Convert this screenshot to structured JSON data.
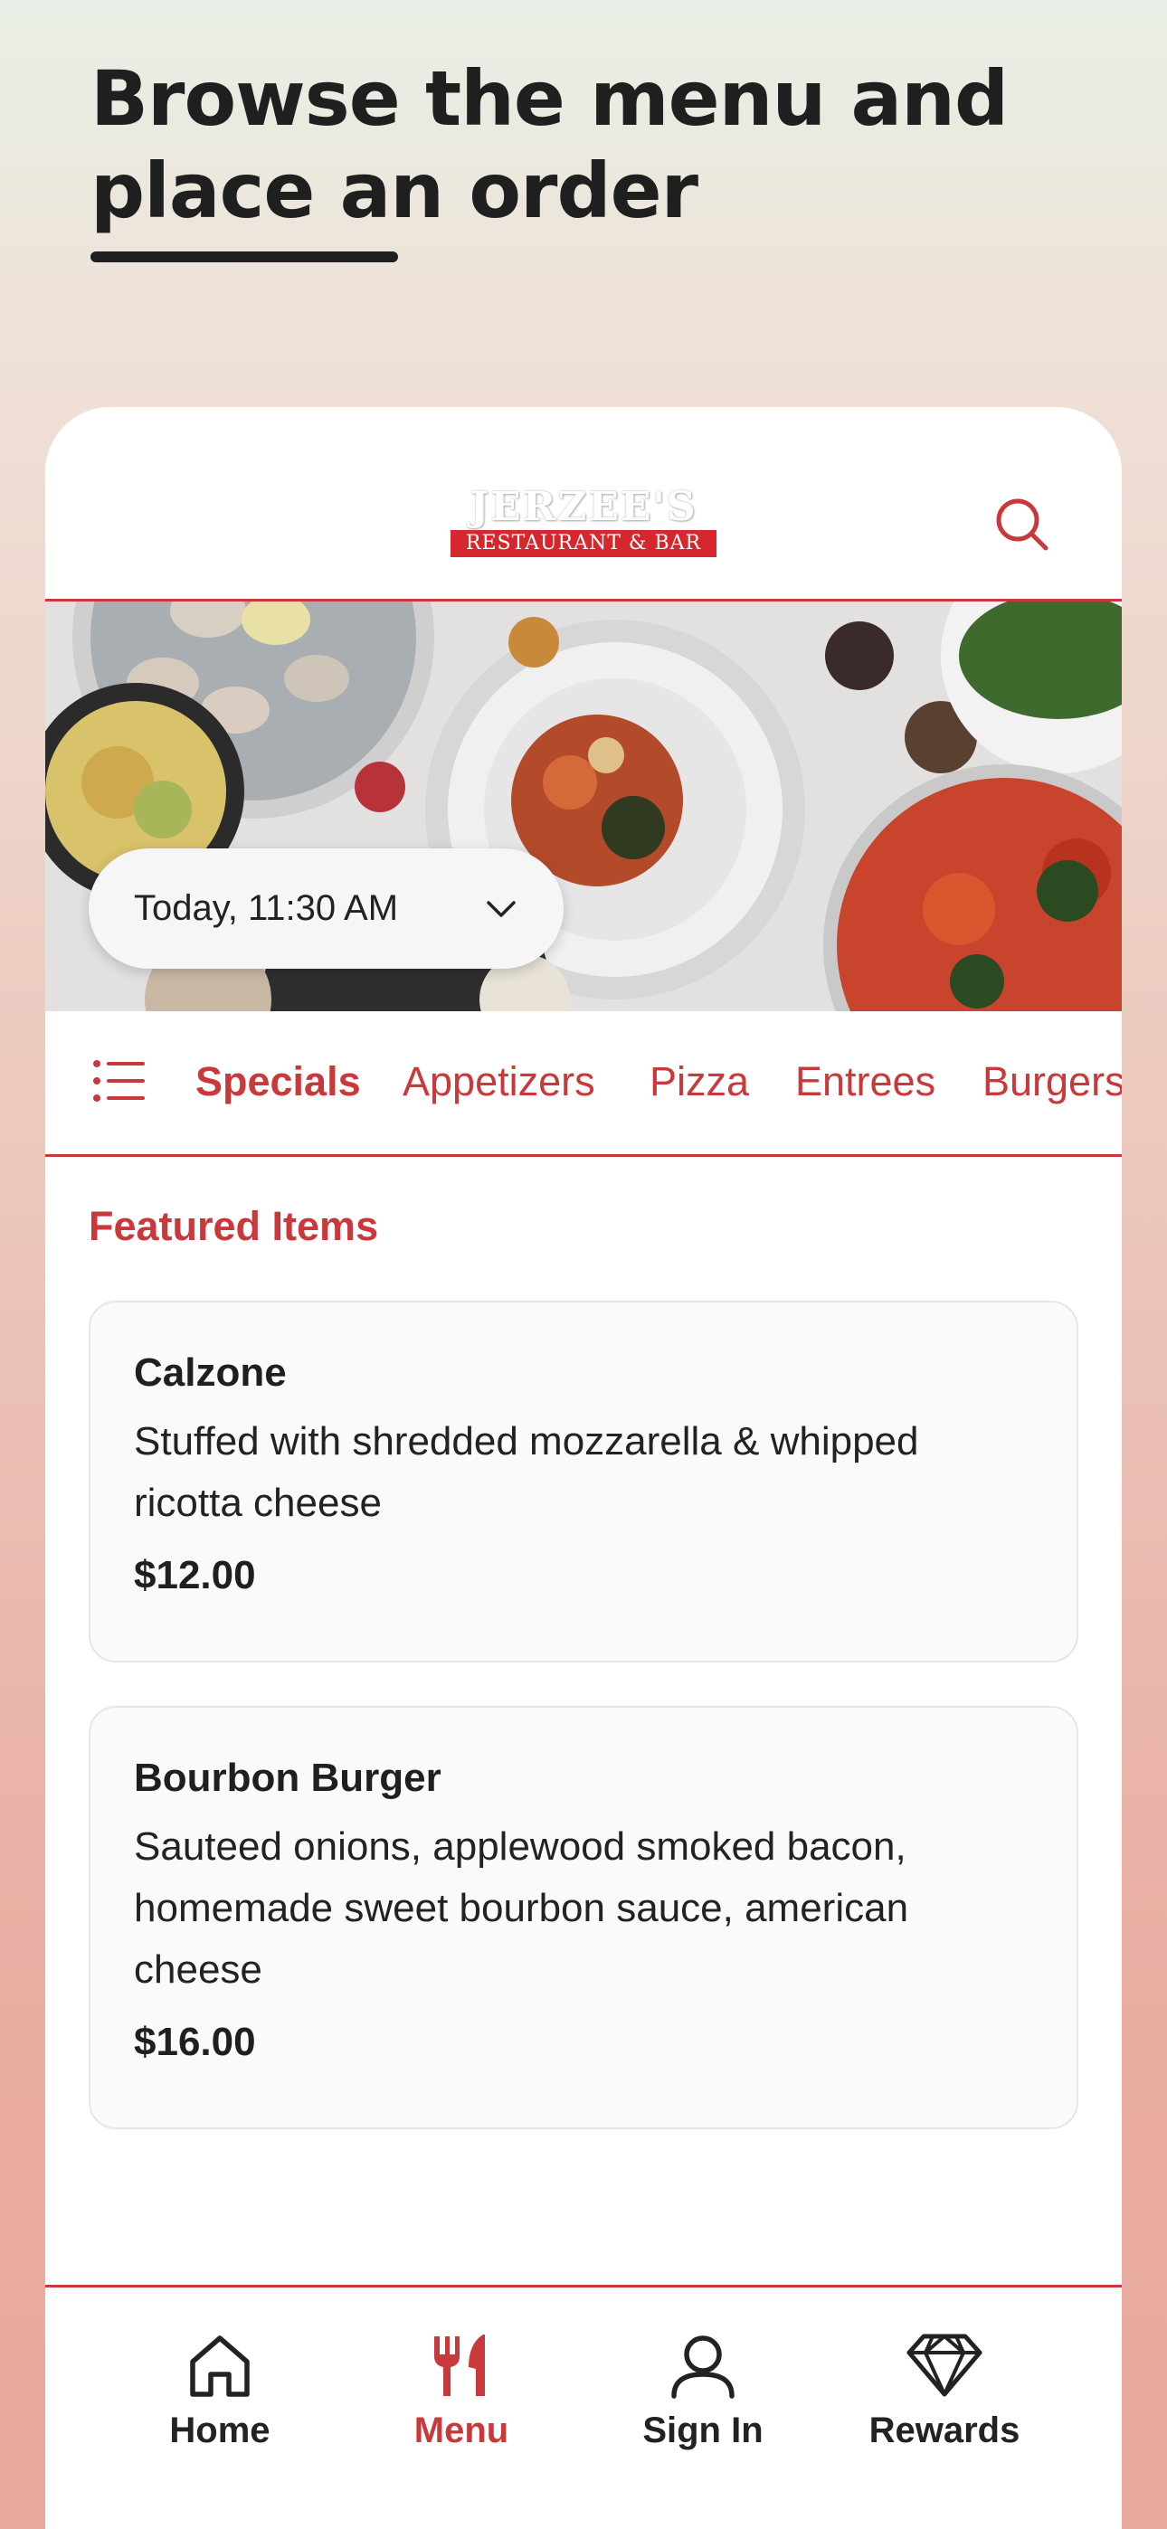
{
  "promo": {
    "headline_line1": "Browse the menu and",
    "headline_line2": "place an order"
  },
  "header": {
    "logo_top": "JERZEE'S",
    "logo_bottom": "RESTAURANT & BAR",
    "search_icon": "search-icon"
  },
  "order_time": {
    "label": "Today, 11:30 AM",
    "icon": "chevron-down-icon"
  },
  "categories": {
    "icon": "list-icon",
    "items": [
      {
        "label": "Specials",
        "active": true
      },
      {
        "label": "Appetizers",
        "active": false
      },
      {
        "label": "Pizza",
        "active": false
      },
      {
        "label": "Entrees",
        "active": false
      },
      {
        "label": "Burgers",
        "active": false
      }
    ]
  },
  "featured": {
    "title": "Featured Items",
    "items": [
      {
        "name": "Calzone",
        "description": "Stuffed with shredded mozzarella & whipped ricotta cheese",
        "price": "$12.00"
      },
      {
        "name": "Bourbon Burger",
        "description": "Sauteed onions, applewood smoked bacon, homemade sweet bourbon sauce, american cheese",
        "price": "$16.00"
      }
    ]
  },
  "bottom_nav": {
    "items": [
      {
        "label": "Home",
        "icon": "home-icon",
        "active": false
      },
      {
        "label": "Menu",
        "icon": "fork-knife-icon",
        "active": true
      },
      {
        "label": "Sign In",
        "icon": "user-icon",
        "active": false
      },
      {
        "label": "Rewards",
        "icon": "diamond-icon",
        "active": false
      }
    ]
  },
  "colors": {
    "accent": "#c9383b",
    "text": "#1f1f1f",
    "card_bg": "#fafafa"
  }
}
